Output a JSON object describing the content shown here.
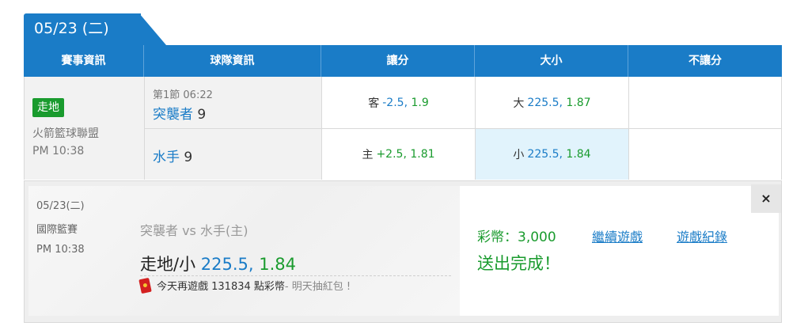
{
  "date_tab": "05/23 (二)",
  "columns": [
    "賽事資訊",
    "球隊資訊",
    "讓分",
    "大小",
    "不讓分"
  ],
  "event": {
    "status_badge": "走地",
    "league": "火箭籃球聯盟",
    "time": "PM 10:38"
  },
  "teams": {
    "period": "第1節 06:22",
    "away_name": "突襲者",
    "away_score": "9",
    "home_name": "水手",
    "home_score": "9"
  },
  "spread": {
    "away_label": "客",
    "away_line": "-2.5",
    "away_odds": "1.9",
    "home_label": "主",
    "home_line": "+2.5",
    "home_odds": "1.81"
  },
  "total": {
    "over_label": "大",
    "over_line": "225.5",
    "over_odds": "1.87",
    "under_label": "小",
    "under_line": "225.5",
    "under_odds": "1.84"
  },
  "slip": {
    "date": "05/23(二)",
    "league": "國際籃賽",
    "time": "PM 10:38",
    "match": "突襲者  vs  水手(主)",
    "pick_label": "走地/小",
    "pick_line": "225.5",
    "pick_odds": "1.84",
    "promo_prefix": "今天再遊戲 131834 點彩幣",
    "promo_suffix": " - 明天抽紅包 !",
    "coins": "彩幣：3,000",
    "continue_link": "繼續遊戲",
    "history_link": "遊戲紀錄",
    "done_text": "送出完成！",
    "close": "×"
  },
  "colors": {
    "brand_blue": "#1a7cc7",
    "green": "#1a9b2e",
    "selected_cell": "#e1f3fc"
  }
}
